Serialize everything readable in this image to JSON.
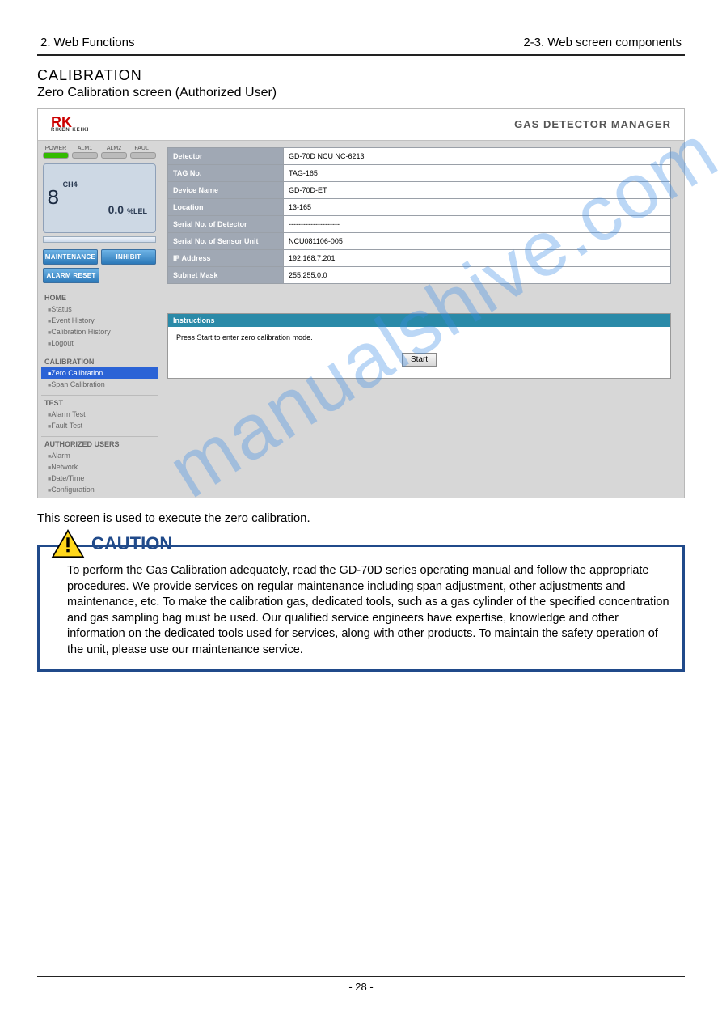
{
  "header": {
    "left": "2. Web Functions",
    "right": "2-3. Web screen components"
  },
  "titles": {
    "main": "CALIBRATION",
    "sub": "Zero Calibration screen (Authorized User)"
  },
  "app": {
    "brand": "RK",
    "brand_sub": "RIKEN KEIKI",
    "product": "GAS  DETECTOR  MANAGER",
    "indicators": {
      "power": "POWER",
      "alm1": "ALM1",
      "alm2": "ALM2",
      "fault": "FAULT"
    },
    "lcd": {
      "gas": "CH4",
      "value": "0.0",
      "unit": "%LEL"
    },
    "buttons": {
      "maintenance": "MAINTENANCE",
      "inhibit": "INHIBIT",
      "alarm_reset": "ALARM RESET"
    },
    "nav": {
      "home": {
        "title": "HOME",
        "items": [
          "Status",
          "Event History",
          "Calibration History",
          "Logout"
        ]
      },
      "calibration": {
        "title": "CALIBRATION",
        "items": [
          "Zero Calibration",
          "Span Calibration"
        ],
        "active_index": 0
      },
      "test": {
        "title": "TEST",
        "items": [
          "Alarm Test",
          "Fault Test"
        ]
      },
      "users": {
        "title": "AUTHORIZED USERS",
        "items": [
          "Alarm",
          "Network",
          "Date/Time",
          "Configuration"
        ]
      }
    },
    "table": {
      "rows": [
        {
          "k": "Detector",
          "v": "GD-70D NCU NC-6213"
        },
        {
          "k": "TAG No.",
          "v": "TAG-165"
        },
        {
          "k": "Device Name",
          "v": "GD-70D-ET"
        },
        {
          "k": "Location",
          "v": "13-165"
        },
        {
          "k": "Serial No. of Detector",
          "v": "---------------------"
        },
        {
          "k": "Serial No. of Sensor Unit",
          "v": "NCU081106-005"
        },
        {
          "k": "IP Address",
          "v": "192.168.7.201"
        },
        {
          "k": "Subnet Mask",
          "v": "255.255.0.0"
        }
      ]
    },
    "instructions": {
      "title": "Instructions",
      "body": "Press Start to enter zero calibration mode.",
      "start": "Start"
    }
  },
  "description": "This screen is used to execute the zero calibration.",
  "caution": {
    "title": "CAUTION",
    "body": "To perform the Gas Calibration adequately, read the GD-70D series operating manual and follow the appropriate procedures.\nWe provide services on regular maintenance including span adjustment, other adjustments and maintenance, etc. To make the calibration gas, dedicated tools, such as a gas cylinder of the specified concentration and gas sampling bag must be used. Our qualified service engineers have expertise, knowledge and other information on the dedicated tools used for services, along with other products. To maintain the safety operation of the unit, please use our maintenance service."
  },
  "watermark": "manualshive.com",
  "page_number": "- 28 -"
}
